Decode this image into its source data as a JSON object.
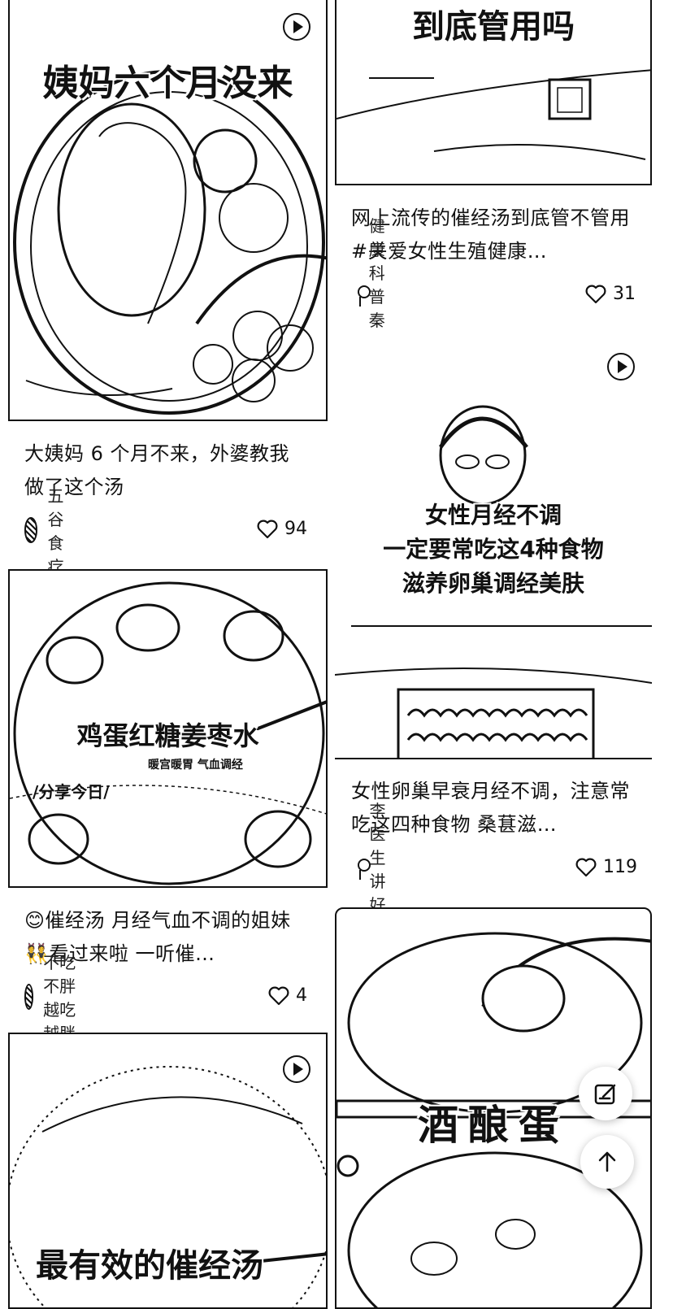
{
  "feed": {
    "left": [
      {
        "overlay": "姨妈六个月没来",
        "title": "大姨妈 6 个月不来，外婆教我做了这个汤",
        "author": "五谷食疗",
        "likes": "94"
      },
      {
        "overlay_main": "鸡蛋红糖姜枣水",
        "overlay_left": "/分享今日/",
        "overlay_small": "暖宫暖胃 气血调经",
        "title": "😊催经汤 月经气血不调的姐妹👯看过来啦 一听催…",
        "author": "不吃不胖越吃越胖",
        "likes": "4"
      },
      {
        "overlay": "最有效的催经汤"
      }
    ],
    "right": [
      {
        "overlay": "到底管用吗",
        "title": "网上流传的催经汤到底管不管用 #关爱女性生殖健康…",
        "author": "健康科普秦医生",
        "likes": "31"
      },
      {
        "overlay_lines": [
          "女性月经不调",
          "一定要常吃这4种食物",
          "滋养卵巢调经美肤"
        ],
        "title": "女性卵巢早衰月经不调，注意常吃这四种食物 桑葚滋…",
        "author": "李医生讲好孕",
        "likes": "119"
      },
      {
        "overlay": "酒酿蛋"
      }
    ]
  },
  "icons": {
    "play": "play-icon",
    "heart": "heart-icon",
    "edit": "edit-icon",
    "scroll_top": "arrow-up-icon"
  }
}
